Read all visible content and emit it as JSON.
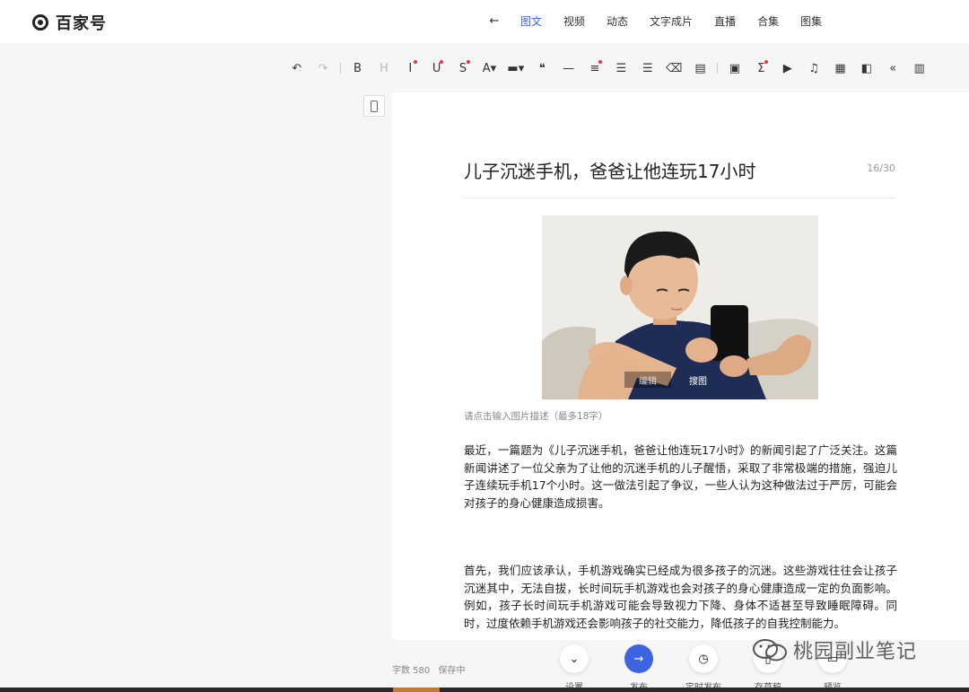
{
  "brand": {
    "name": "百家号"
  },
  "nav": {
    "back_icon": "←",
    "tabs": [
      {
        "label": "图文",
        "active": true
      },
      {
        "label": "视频"
      },
      {
        "label": "动态"
      },
      {
        "label": "文字成片"
      },
      {
        "label": "直播"
      },
      {
        "label": "合集"
      },
      {
        "label": "图集"
      }
    ]
  },
  "toolbar": {
    "items": [
      {
        "name": "undo-icon",
        "glyph": "↶"
      },
      {
        "name": "redo-icon",
        "glyph": "↷",
        "dim": true
      },
      {
        "name": "bold-icon",
        "glyph": "B"
      },
      {
        "name": "heading-icon",
        "glyph": "H",
        "dim": true
      },
      {
        "name": "italic-icon",
        "glyph": "I",
        "dot": true
      },
      {
        "name": "underline-icon",
        "glyph": "U",
        "dot": true
      },
      {
        "name": "strikethrough-icon",
        "glyph": "S",
        "dot": true
      },
      {
        "name": "font-color-icon",
        "glyph": "A▾"
      },
      {
        "name": "highlight-icon",
        "glyph": "▬▾"
      },
      {
        "name": "quote-icon",
        "glyph": "❝"
      },
      {
        "name": "horizontal-rule-icon",
        "glyph": "—"
      },
      {
        "name": "align-icon",
        "glyph": "≡",
        "dot": true
      },
      {
        "name": "ordered-list-icon",
        "glyph": "☰"
      },
      {
        "name": "bullet-list-icon",
        "glyph": "☰"
      },
      {
        "name": "eraser-icon",
        "glyph": "⌫"
      },
      {
        "name": "format-painter-icon",
        "glyph": "▤"
      },
      {
        "name": "image-icon",
        "glyph": "▣"
      },
      {
        "name": "formula-icon",
        "glyph": "Σ",
        "dot": true
      },
      {
        "name": "video-icon",
        "glyph": "▶"
      },
      {
        "name": "audio-icon",
        "glyph": "♫"
      },
      {
        "name": "table-icon",
        "glyph": "▦"
      },
      {
        "name": "card-icon",
        "glyph": "◧"
      },
      {
        "name": "code-icon",
        "glyph": "«"
      },
      {
        "name": "chart-icon",
        "glyph": "▥"
      }
    ]
  },
  "editor": {
    "title": "儿子沉迷手机，爸爸让他连玩17小时",
    "title_count": "16/30",
    "image_buttons": {
      "edit": "编辑",
      "search": "搜图"
    },
    "caption_placeholder": "请点击输入图片描述（最多18字）",
    "paragraph1": "最近，一篇题为《儿子沉迷手机，爸爸让他连玩17小时》的新闻引起了广泛关注。这篇新闻讲述了一位父亲为了让他的沉迷手机的儿子醒悟，采取了非常极端的措施，强迫儿子连续玩手机17个小时。这一做法引起了争议，一些人认为这种做法过于严厉，可能会对孩子的身心健康造成损害。",
    "paragraph2": "首先，我们应该承认，手机游戏确实已经成为很多孩子的沉迷。这些游戏往往会让孩子沉迷其中，无法自拔，长时间玩手机游戏也会对孩子的身心健康造成一定的负面影响。例如，孩子长时间玩手机游戏可能会导致视力下降、身体不适甚至导致睡眠障碍。同时，过度依赖手机游戏还会影响孩子的社交能力，降低孩子的自我控制能力。"
  },
  "footer": {
    "word_count": "字数 580",
    "save_status": "保存中",
    "actions": [
      {
        "name": "settings",
        "label": "设置",
        "glyph": "⌄"
      },
      {
        "name": "publish",
        "label": "发布",
        "glyph": "→",
        "primary": true
      },
      {
        "name": "schedule",
        "label": "定时发布",
        "glyph": "◷"
      },
      {
        "name": "draft",
        "label": "存草稿",
        "glyph": "▯"
      },
      {
        "name": "preview",
        "label": "预览",
        "glyph": "▭"
      }
    ]
  },
  "watermark": {
    "text": "桃园副业笔记"
  },
  "colors": {
    "accent": "#3c63e0",
    "dot": "#e33333"
  }
}
